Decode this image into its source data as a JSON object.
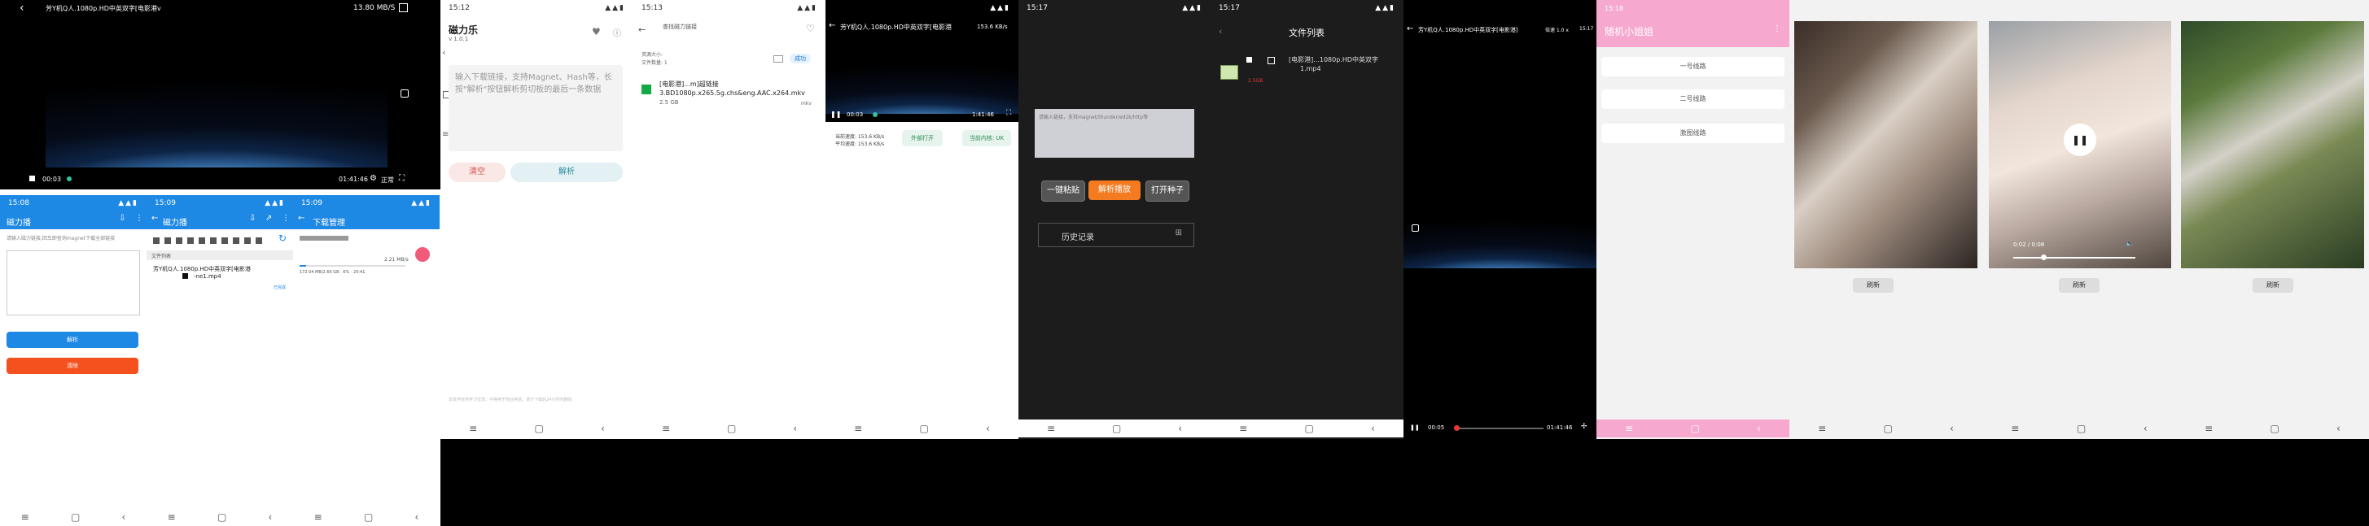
{
  "p1": {
    "title": "芳Y机Q人.1080p.HD中英双字[电影港v",
    "speed": "13.80 MB/S",
    "time_left": "00:03",
    "time_right": "01:41:46",
    "speed_tag": "正常"
  },
  "p2": {
    "time": "15:08",
    "title": "磁力播",
    "placeholder": "请输入磁力链接,回车即查询magnet下载全部链接",
    "btn_parse": "解析",
    "btn_clear": "清除"
  },
  "p3": {
    "time": "15:09",
    "title": "磁力播",
    "section": "文件列表",
    "file_name": "芳Y机Q人.1080p.HD中英双字[电影港",
    "file_ext": "-ne1.mp4",
    "action": "已完成"
  },
  "p4": {
    "time": "15:09",
    "title": "下载管理",
    "size": "2.21 MB/s",
    "info": "172.04 MB/2.66 GB · 6% · 20:41"
  },
  "p5": {
    "time": "15:12",
    "title": "磁力乐",
    "version": "v 1.0.1",
    "placeholder": "输入下载链接，支持Magnet、Hash等，长按\"解析\"按钮解析剪切板的最后一条数据",
    "btn_clear": "清空",
    "btn_parse": "解析",
    "footer": "本软件仅供学习交流，不得用于商业用途，请于下载后24小时内删除"
  },
  "p6": {
    "time": "15:13",
    "header_label": "查找磁力链接",
    "total_label": "资源大小:",
    "count_label": "文件数量: 1",
    "state": "成功",
    "file_name": "[电影港]...m]超链接",
    "file_full": "3.BD1080p.x265.5g.chs&eng.AAC.x264.mkv",
    "file_size": "2.5 GB",
    "file_type": "mkv"
  },
  "p7": {
    "title": "芳Y机Q人.1080p.HD中英双字[电影港",
    "speed": "153.6 KB/s",
    "time_left": "00:03",
    "time_right": "1:41:46",
    "cur_speed": "当前速度: 153.6 KB/s",
    "avg_speed": "平均速度: 153.6 KB/s",
    "btn_external": "外部打开",
    "btn_kernel": "当前内核: UK"
  },
  "p8": {
    "time": "15:17",
    "placeholder": "请输入链接，支持magnet/thunder/ed2k/http等",
    "btn_paste": "一键粘贴",
    "btn_play": "解析播放",
    "btn_torrent": "打开种子",
    "history": "历史记录"
  },
  "p9": {
    "time": "15:17",
    "title": "文件列表",
    "file_name": "[电影港]...1080p.HD中英双字",
    "file_ext": "1.mp4",
    "size_tag": "2.5GB"
  },
  "p10": {
    "title": "芳Y机Q人.1080p.HD中英双字[电影港]",
    "speed": "倍速 1.0 x",
    "clock": "15:17",
    "time_left": "00:05",
    "time_right": "01:41:46"
  },
  "p11": {
    "time": "15:18",
    "title": "随机小姐姐",
    "line1": "一号线路",
    "line2": "二号线路",
    "line3": "激图线路"
  },
  "p12": {
    "btn": "刷新"
  },
  "p13": {
    "btn": "刷新",
    "time_label": "0:02 / 0:08"
  },
  "p14": {
    "btn": "刷新"
  },
  "colors": {
    "blue": "#1e88e5",
    "orange": "#f4511e",
    "pink": "#f7a8cf",
    "dark": "#1c1c1c"
  }
}
